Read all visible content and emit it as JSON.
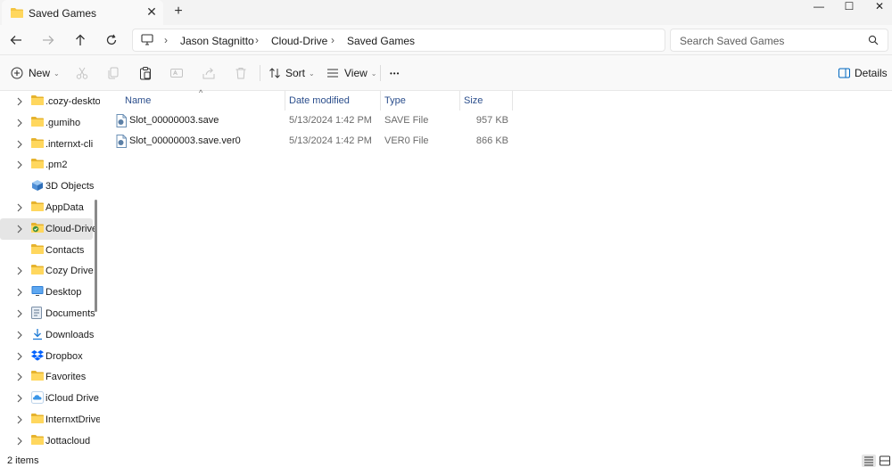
{
  "window": {
    "tab_title": "Saved Games",
    "new_tab_symbol": "+",
    "close_tab_symbol": "✕",
    "minimize_symbol": "—",
    "maximize_symbol": "☐",
    "close_symbol": "✕"
  },
  "address": {
    "breadcrumbs": [
      "Jason Stagnitto",
      "Cloud-Drive",
      "Saved Games"
    ],
    "separator": "›",
    "search_placeholder": "Search Saved Games"
  },
  "toolbar": {
    "new_label": "New",
    "sort_label": "Sort",
    "view_label": "View",
    "more_label": "•••",
    "details_label": "Details",
    "caret": "⌄"
  },
  "nav": {
    "items": [
      {
        "label": ".cozy-deskto",
        "icon": "folder-icon",
        "expandable": true,
        "selected": false
      },
      {
        "label": ".gumiho",
        "icon": "folder-icon",
        "expandable": true,
        "selected": false
      },
      {
        "label": ".internxt-cli",
        "icon": "folder-icon",
        "expandable": true,
        "selected": false
      },
      {
        "label": ".pm2",
        "icon": "folder-icon",
        "expandable": true,
        "selected": false
      },
      {
        "label": "3D Objects",
        "icon": "cube-icon",
        "expandable": false,
        "selected": false
      },
      {
        "label": "AppData",
        "icon": "folder-icon",
        "expandable": true,
        "selected": false
      },
      {
        "label": "Cloud-Drive",
        "icon": "cloud-folder-icon",
        "expandable": true,
        "selected": true
      },
      {
        "label": "Contacts",
        "icon": "folder-icon",
        "expandable": false,
        "selected": false
      },
      {
        "label": "Cozy Drive",
        "icon": "folder-icon",
        "expandable": true,
        "selected": false
      },
      {
        "label": "Desktop",
        "icon": "desktop-icon",
        "expandable": true,
        "selected": false
      },
      {
        "label": "Documents",
        "icon": "documents-icon",
        "expandable": true,
        "selected": false
      },
      {
        "label": "Downloads",
        "icon": "download-icon",
        "expandable": true,
        "selected": false
      },
      {
        "label": "Dropbox",
        "icon": "dropbox-icon",
        "expandable": true,
        "selected": false
      },
      {
        "label": "Favorites",
        "icon": "folder-icon",
        "expandable": true,
        "selected": false
      },
      {
        "label": "iCloud Drive",
        "icon": "icloud-icon",
        "expandable": true,
        "selected": false
      },
      {
        "label": "InternxtDrive",
        "icon": "folder-icon",
        "expandable": true,
        "selected": false
      },
      {
        "label": "Jottacloud",
        "icon": "folder-icon",
        "expandable": true,
        "selected": false
      }
    ]
  },
  "columns": {
    "name": "Name",
    "date": "Date modified",
    "type": "Type",
    "size": "Size",
    "sort_indicator": "^"
  },
  "files": [
    {
      "name": "Slot_00000003.save",
      "date": "5/13/2024 1:42 PM",
      "type": "SAVE File",
      "size": "957 KB"
    },
    {
      "name": "Slot_00000003.save.ver0",
      "date": "5/13/2024 1:42 PM",
      "type": "VER0 File",
      "size": "866 KB"
    }
  ],
  "status": {
    "item_count": "2 items"
  },
  "colors": {
    "folder": "#f4c542",
    "accent": "#0067c0",
    "header_text": "#2b4e8c",
    "selected_bg": "#e5e5e5"
  }
}
